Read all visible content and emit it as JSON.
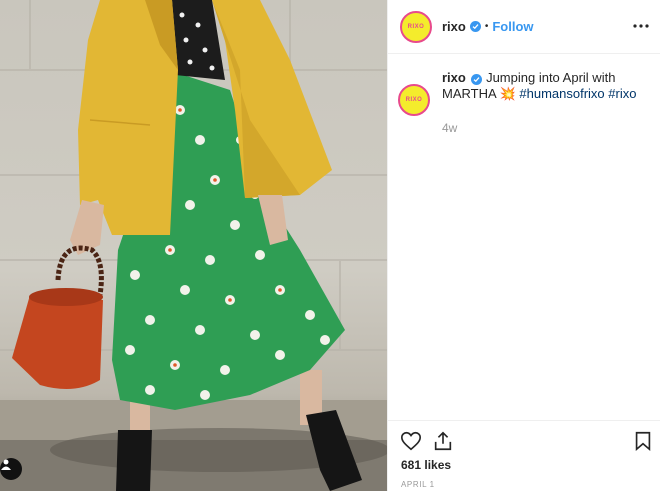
{
  "post": {
    "username": "rixo",
    "avatar_text": "RIXO",
    "follow_label": "Follow",
    "separator": "•",
    "more_icon": "more-horizontal-icon",
    "caption": {
      "username": "rixo",
      "text": " Jumping into April with MARTHA ",
      "emoji": "💥",
      "hashtag_1": "#humansofrixo",
      "hashtag_2": "#rixo",
      "time": "4w"
    },
    "likes": "681 likes",
    "date": "APRIL 1"
  },
  "colors": {
    "accent_blue": "#3897f0",
    "hashtag": "#003569",
    "avatar_bg": "#f4ec2c",
    "avatar_ring": "#e84a8c",
    "coat": "#e2b734",
    "skirt": "#2f9e54",
    "bag": "#c4461f"
  },
  "icons": [
    "heart-icon",
    "share-icon",
    "bookmark-icon",
    "verified-badge-icon",
    "user-tag-icon"
  ]
}
